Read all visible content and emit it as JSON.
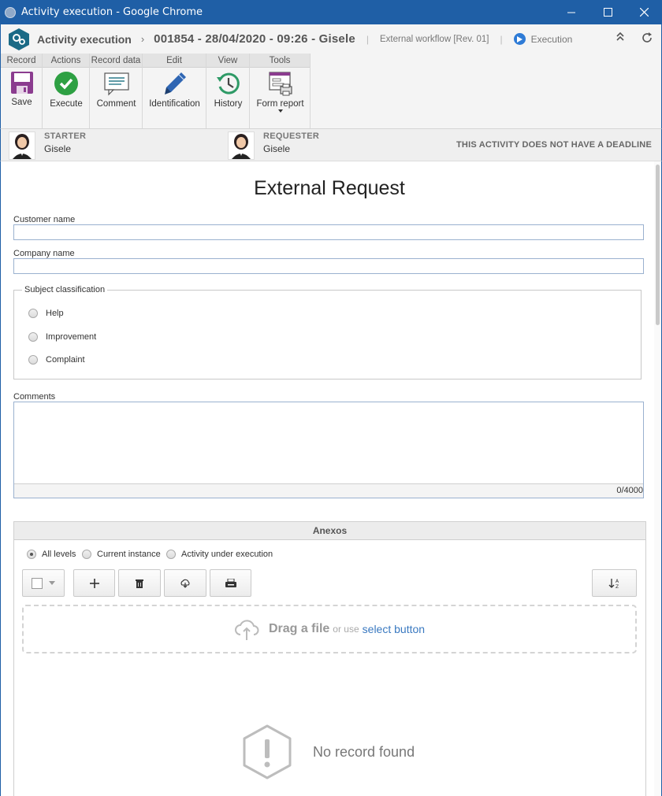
{
  "window": {
    "title": "Activity execution - Google Chrome"
  },
  "header": {
    "app_name": "Activity execution",
    "record_title": "001854 - 28/04/2020 - 09:26 - Gisele",
    "workflow": "External workflow [Rev. 01]",
    "status": "Execution"
  },
  "ribbon": {
    "groups": [
      {
        "title": "Record",
        "buttons": [
          {
            "label": "Save",
            "icon": "save-icon"
          }
        ]
      },
      {
        "title": "Actions",
        "buttons": [
          {
            "label": "Execute",
            "icon": "check-icon"
          }
        ]
      },
      {
        "title": "Record data",
        "buttons": [
          {
            "label": "Comment",
            "icon": "comment-icon"
          }
        ]
      },
      {
        "title": "Edit",
        "buttons": [
          {
            "label": "Identification",
            "icon": "pencil-icon"
          }
        ]
      },
      {
        "title": "View",
        "buttons": [
          {
            "label": "History",
            "icon": "history-icon"
          }
        ]
      },
      {
        "title": "Tools",
        "buttons": [
          {
            "label": "Form report",
            "icon": "form-report-icon"
          }
        ]
      }
    ]
  },
  "people": {
    "starter_label": "STARTER",
    "starter_name": "Gisele",
    "requester_label": "REQUESTER",
    "requester_name": "Gisele",
    "deadline_text": "THIS ACTIVITY DOES NOT HAVE A DEADLINE"
  },
  "form": {
    "title": "External Request",
    "customer_label": "Customer name",
    "customer_value": "",
    "company_label": "Company name",
    "company_value": "",
    "subject_legend": "Subject classification",
    "subject_options": [
      "Help",
      "Improvement",
      "Complaint"
    ],
    "comments_label": "Comments",
    "comments_value": "",
    "comments_counter": "0/4000"
  },
  "attachments": {
    "title": "Anexos",
    "levels": [
      "All levels",
      "Current instance",
      "Activity under execution"
    ],
    "selected_level": "All levels",
    "drop_text": "Drag a file",
    "drop_or": "or use",
    "drop_link": "select button",
    "empty_text": "No record found"
  },
  "colors": {
    "window_frame": "#1f5fa6",
    "execution_blue": "#2e7bd6",
    "execute_green": "#2ea043",
    "save_purple": "#8b3c8f",
    "link_blue": "#3a79c0"
  }
}
